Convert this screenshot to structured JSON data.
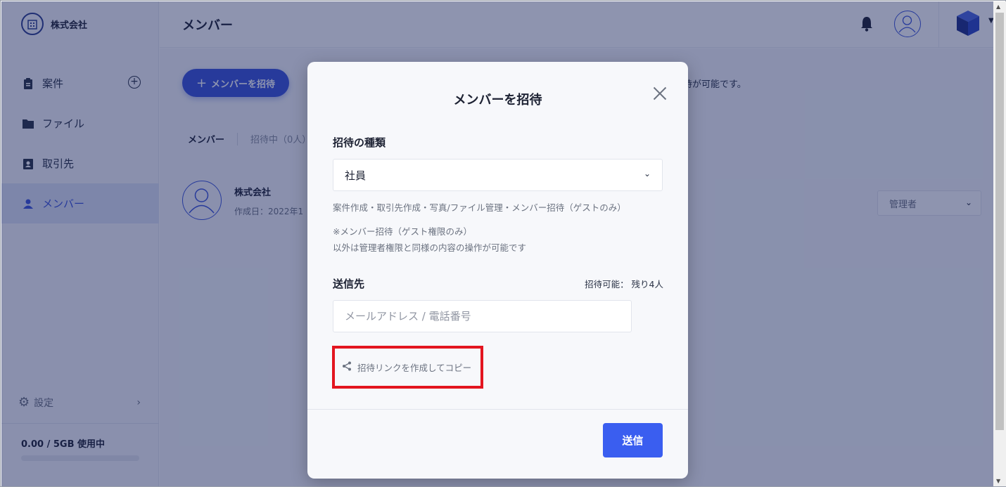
{
  "company": {
    "name": "株式会社",
    "logo_icon": "building-icon"
  },
  "sidebar": {
    "items": [
      {
        "label": "案件",
        "icon": "clipboard-icon"
      },
      {
        "label": "ファイル",
        "icon": "folder-icon"
      },
      {
        "label": "取引先",
        "icon": "contact-badge-icon"
      },
      {
        "label": "メンバー",
        "icon": "person-icon",
        "active": true
      }
    ],
    "settings_label": "設定",
    "storage_label": "0.00 / 5GB 使用中"
  },
  "header": {
    "title": "メンバー"
  },
  "main": {
    "invite_button_label": "メンバーを招待",
    "invite_note": "待が可能です。",
    "tabs": [
      {
        "label": "メンバー"
      },
      {
        "label": "招待中（0人）"
      }
    ],
    "member": {
      "name": "株式会社",
      "created": "作成日：2022年1",
      "role": "管理者"
    }
  },
  "modal": {
    "title": "メンバーを招待",
    "type_label": "招待の種類",
    "type_value": "社員",
    "type_description": "案件作成・取引先作成・写真/ファイル管理・メンバー招待（ゲストのみ）",
    "note_line1": "※メンバー招待（ゲスト権限のみ）",
    "note_line2": "以外は管理者権限と同様の内容の操作が可能です",
    "recipient_label": "送信先",
    "quota": "招待可能： 残り4人",
    "recipient_placeholder": "メールアドレス / 電話番号",
    "copy_link_label": "招待リンクを作成してコピー",
    "send_label": "送信"
  },
  "colors": {
    "accent": "#3a54d8",
    "highlight_box": "#e3151f",
    "overlay": "#122058"
  }
}
